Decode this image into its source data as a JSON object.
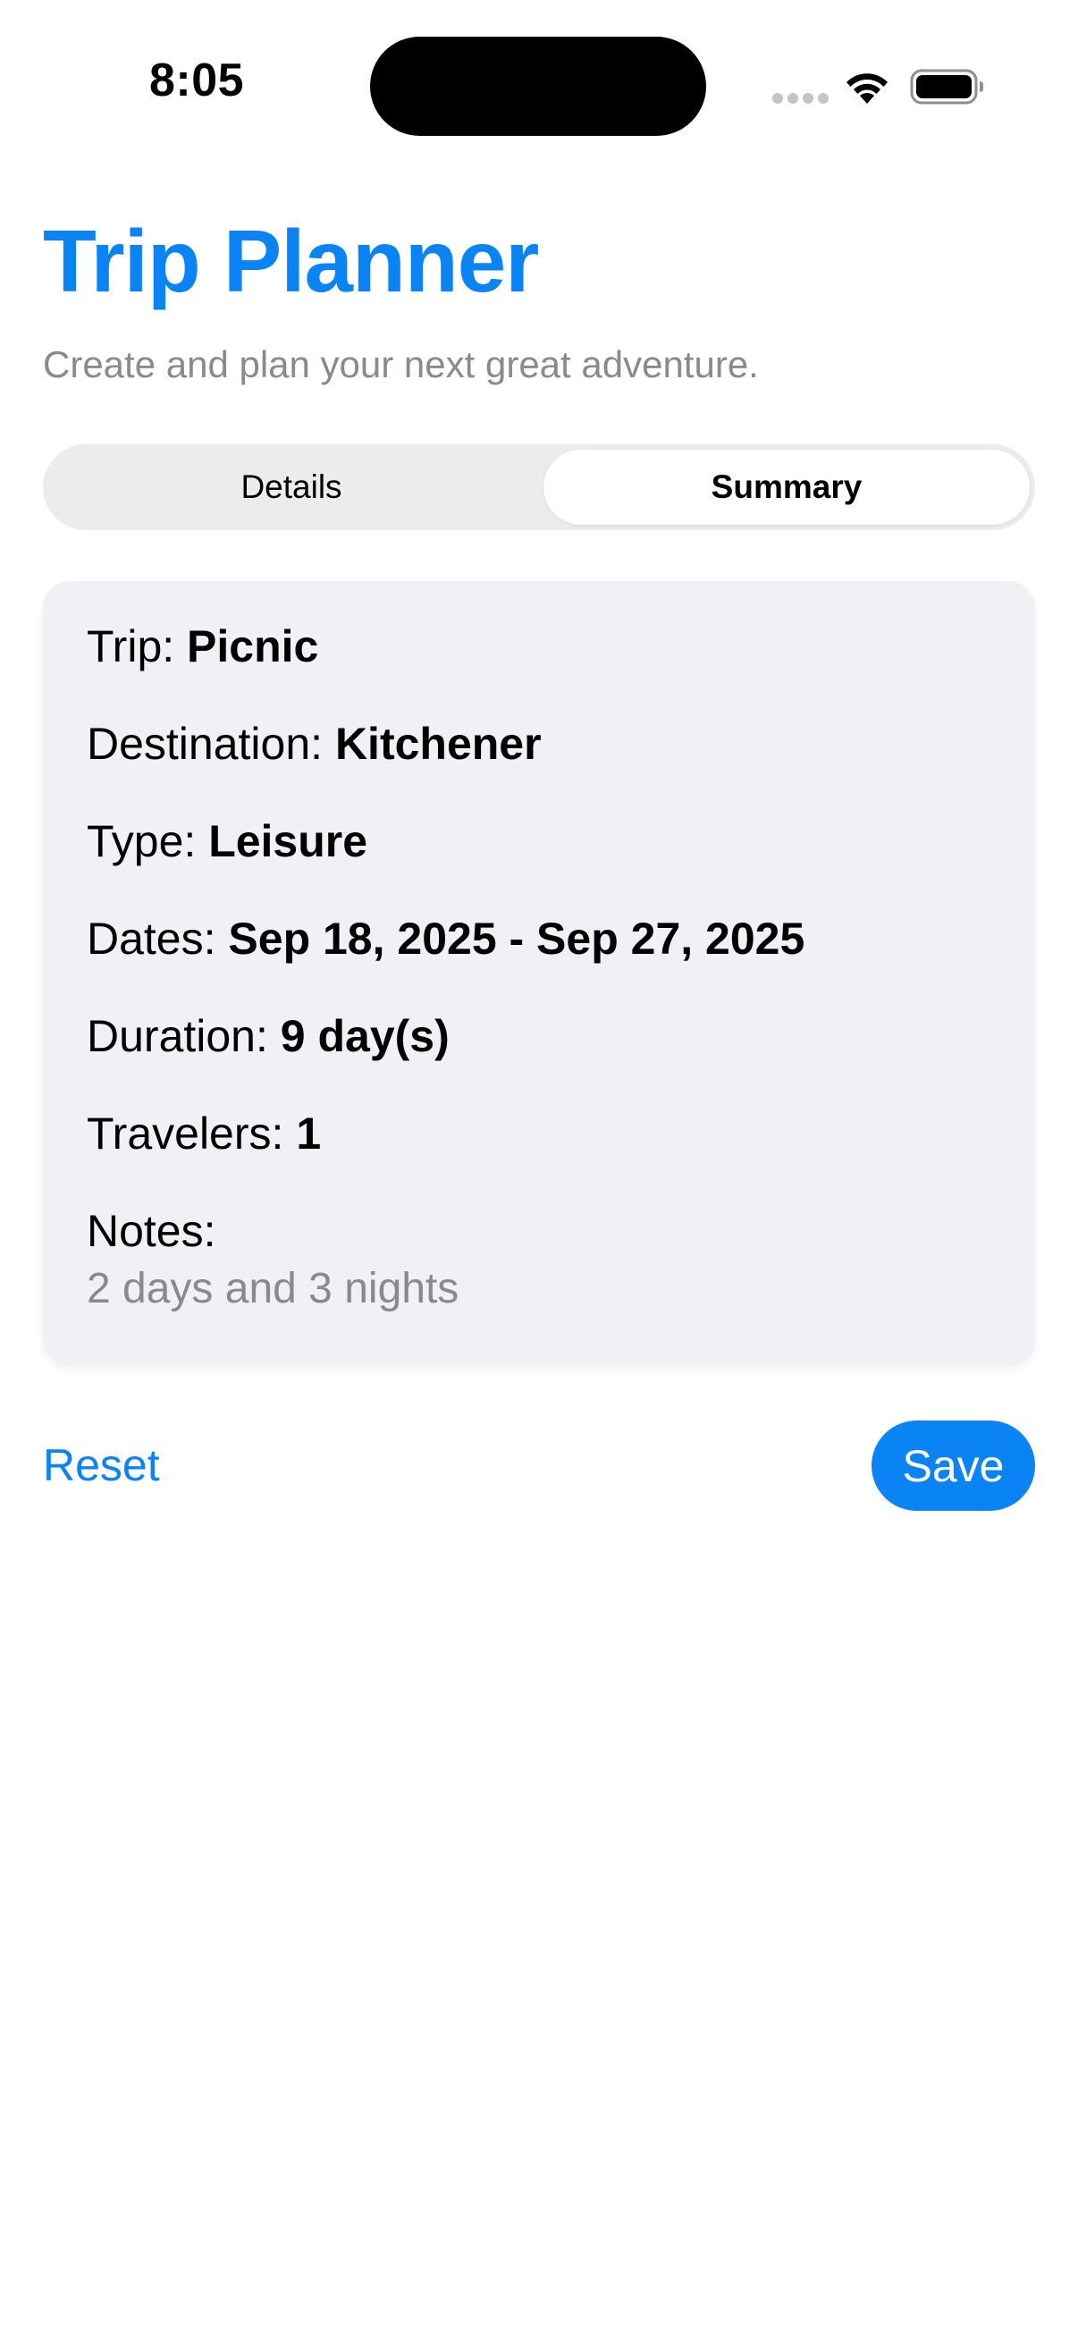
{
  "status_bar": {
    "time": "8:05",
    "icons": [
      "cellular-signal-icon",
      "wifi-icon",
      "battery-icon"
    ]
  },
  "header": {
    "title": "Trip Planner",
    "subtitle": "Create and plan your next great adventure."
  },
  "tabs": [
    {
      "label": "Details",
      "selected": false
    },
    {
      "label": "Summary",
      "selected": true
    }
  ],
  "summary": {
    "trip": {
      "label": "Trip:",
      "value": "Picnic"
    },
    "destination": {
      "label": "Destination:",
      "value": "Kitchener"
    },
    "type": {
      "label": "Type:",
      "value": "Leisure"
    },
    "dates": {
      "label": "Dates:",
      "value": "Sep 18, 2025 - Sep 27, 2025"
    },
    "duration": {
      "label": "Duration:",
      "value": "9 day(s)"
    },
    "travelers": {
      "label": "Travelers:",
      "value": "1"
    },
    "notes": {
      "label": "Notes:",
      "value": "2 days and 3 nights"
    }
  },
  "actions": {
    "reset_label": "Reset",
    "save_label": "Save"
  },
  "colors": {
    "accent": "#0a84f5",
    "secondary_text": "#8a8a8e",
    "card_background": "#f1f1f5",
    "segmented_background": "#ececec"
  }
}
